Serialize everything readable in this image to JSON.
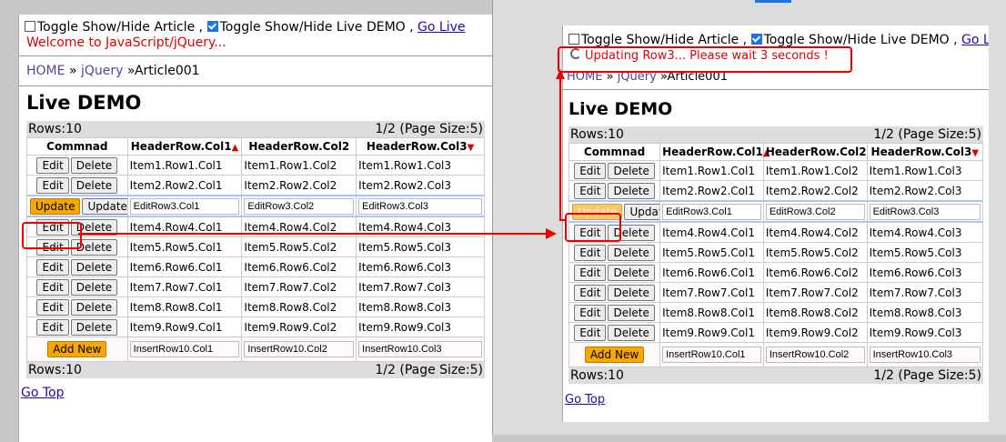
{
  "toolbar": {
    "toggle_article": "Toggle Show/Hide Article ,",
    "toggle_demo": "Toggle Show/Hide Live DEMO ,",
    "go_live": "Go Live"
  },
  "left": {
    "message": "Welcome to JavaScript/jQuery...",
    "breadcrumb": {
      "home": "HOME",
      "sep1": "»",
      "jquery": "jQuery",
      "sep2": "»",
      "page": "Article001"
    },
    "title": "Live DEMO",
    "rows_label": "Rows:10",
    "pager": "1/2 (Page Size:5)",
    "go_top": "Go Top"
  },
  "right": {
    "message": "Updating Row3... Please wait 3 seconds !",
    "breadcrumb": {
      "home": "HOME",
      "sep1": "»",
      "jquery": "jQuery",
      "sep2": "»",
      "page": "Article001"
    },
    "title": "Live DEMO",
    "rows_label": "Rows:10",
    "pager": "1/2 (Page Size:5)",
    "go_top": "Go Top"
  },
  "grid": {
    "headers": [
      "Commnad",
      "HeaderRow.Col1",
      "HeaderRow.Col2",
      "HeaderRow.Col3"
    ],
    "edit_label": "Edit",
    "delete_label": "Delete",
    "update_label": "Update",
    "add_label": "Add New",
    "rows": [
      [
        "Item1.Row1.Col1",
        "Item1.Row1.Col2",
        "Item1.Row1.Col3"
      ],
      [
        "Item2.Row2.Col1",
        "Item2.Row2.Col2",
        "Item2.Row2.Col3"
      ],
      [
        "EditRow3.Col1",
        "EditRow3.Col2",
        "EditRow3.Col3"
      ],
      [
        "Item4.Row4.Col1",
        "Item4.Row4.Col2",
        "Item4.Row4.Col3"
      ],
      [
        "Item5.Row5.Col1",
        "Item5.Row5.Col2",
        "Item5.Row5.Col3"
      ],
      [
        "Item6.Row6.Col1",
        "Item6.Row6.Col2",
        "Item6.Row6.Col3"
      ],
      [
        "Item7.Row7.Col1",
        "Item7.Row7.Col2",
        "Item7.Row7.Col3"
      ],
      [
        "Item8.Row8.Col1",
        "Item8.Row8.Col2",
        "Item8.Row8.Col3"
      ],
      [
        "Item9.Row9.Col1",
        "Item9.Row9.Col2",
        "Item9.Row9.Col3"
      ]
    ],
    "insert": [
      "InsertRow10.Col1",
      "InsertRow10.Col2",
      "InsertRow10.Col3"
    ]
  },
  "colors": {
    "highlight": "#e00000",
    "accent_button": "#f7a800",
    "message": "#dd0000"
  }
}
